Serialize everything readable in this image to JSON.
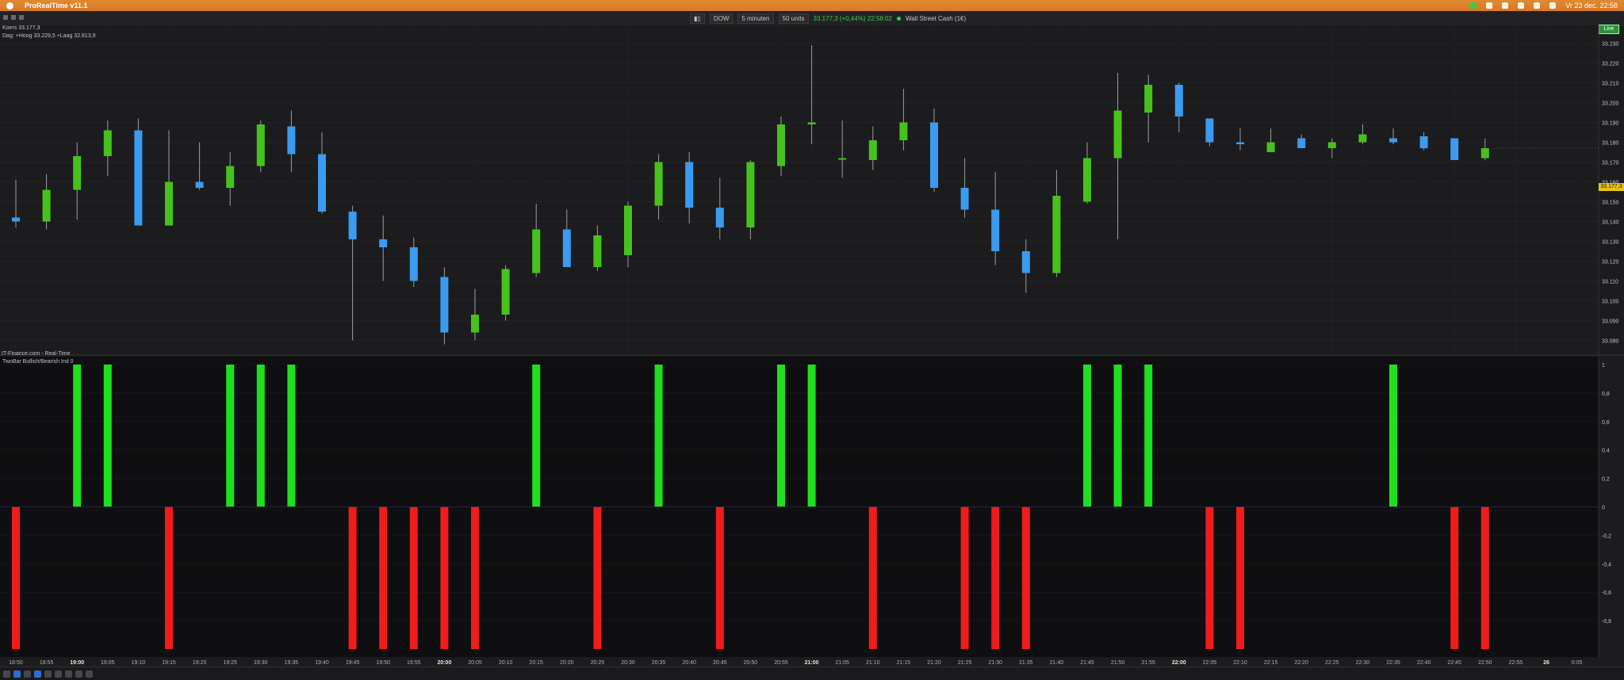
{
  "app": {
    "title": "ProRealTime v11.1",
    "clock": "Vr 23 dec. 22:58"
  },
  "toolbar": {
    "instrument": "DOW",
    "timeframe": "5 minuten",
    "units": "50 units",
    "price_text": "33.177,3 (+0,44%) 22:58:02",
    "market_name": "Wall Street Cash (1€)"
  },
  "chart": {
    "legend_line1": "Koers 33.177,3",
    "legend_line2": "Dag: +Hoog 33.229,5 +Laag 32.813,9",
    "source_label": "IT-Finance.com - Real-Time",
    "indicator_label": "TwoBar Bullish/Bearish Ind 0",
    "mode_badge": "Live",
    "last_price_badge": "33.177,3",
    "price_axis_labels": [
      "33.230",
      "33.220",
      "33.210",
      "33.200",
      "33.190",
      "33.180",
      "33.170",
      "33.160",
      "33.150",
      "33.140",
      "33.130",
      "33.120",
      "33.110",
      "33.100",
      "33.090",
      "33.080"
    ],
    "indicator_axis_labels": [
      "1",
      "0,8",
      "0,6",
      "0,4",
      "0,2",
      "0",
      "-0,2",
      "-0,4",
      "-0,6",
      "-0,8"
    ],
    "time_labels": [
      "18:50",
      "18:55",
      "19:00",
      "19:05",
      "19:10",
      "19:15",
      "19:20",
      "19:25",
      "19:30",
      "19:35",
      "19:40",
      "19:45",
      "19:50",
      "19:55",
      "20:00",
      "20:05",
      "20:10",
      "20:15",
      "20:20",
      "20:25",
      "20:30",
      "20:35",
      "20:40",
      "20:45",
      "20:50",
      "20:55",
      "21:00",
      "21:05",
      "21:10",
      "21:15",
      "21:20",
      "21:25",
      "21:30",
      "21:35",
      "21:40",
      "21:45",
      "21:50",
      "21:55",
      "22:00",
      "22:05",
      "22:10",
      "22:15",
      "22:20",
      "22:25",
      "22:30",
      "22:35",
      "22:40",
      "22:45",
      "22:50",
      "22:55",
      "26",
      "0:05"
    ],
    "bold_time_labels": [
      "19:00",
      "20:00",
      "21:00",
      "22:00",
      "26"
    ],
    "colors": {
      "bull": "#47c21c",
      "bear": "#3a9bf0",
      "ind_bull": "#1ee01e",
      "ind_bear": "#f01c1c",
      "background": "#1c1c1e",
      "grid": "#2a2a2d"
    }
  },
  "chart_data": {
    "type": "candlestick",
    "x": [
      "18:50",
      "18:55",
      "19:00",
      "19:05",
      "19:10",
      "19:15",
      "19:20",
      "19:25",
      "19:30",
      "19:35",
      "19:40",
      "19:45",
      "19:50",
      "19:55",
      "20:00",
      "20:05",
      "20:10",
      "20:15",
      "20:20",
      "20:25",
      "20:30",
      "20:35",
      "20:40",
      "20:45",
      "20:50",
      "20:55",
      "21:00",
      "21:05",
      "21:10",
      "21:15",
      "21:20",
      "21:25",
      "21:30",
      "21:35",
      "21:40",
      "21:45",
      "21:50",
      "21:55",
      "22:00",
      "22:05",
      "22:10",
      "22:15",
      "22:20",
      "22:25",
      "22:30",
      "22:35",
      "22:40",
      "22:45",
      "22:50"
    ],
    "open": [
      33142,
      33140,
      33156,
      33173,
      33186,
      33138,
      33160,
      33157,
      33168,
      33188,
      33174,
      33145,
      33131,
      33127,
      33112,
      33084,
      33093,
      33114,
      33136,
      33117,
      33123,
      33148,
      33170,
      33147,
      33137,
      33168,
      33189,
      33172,
      33171,
      33181,
      33190,
      33157,
      33146,
      33125,
      33114,
      33150,
      33172,
      33195,
      33209,
      33192,
      33180,
      33175,
      33182,
      33177,
      33180,
      33182,
      33183,
      33182,
      33172
    ],
    "high": [
      33161,
      33164,
      33180,
      33191,
      33192,
      33186,
      33180,
      33175,
      33191,
      33196,
      33185,
      33148,
      33143,
      33132,
      33117,
      33106,
      33118,
      33149,
      33146,
      33138,
      33150,
      33174,
      33175,
      33162,
      33171,
      33193,
      33229,
      33191,
      33188,
      33207,
      33197,
      33172,
      33165,
      33131,
      33166,
      33180,
      33215,
      33214,
      33210,
      33192,
      33187,
      33187,
      33184,
      33182,
      33189,
      33187,
      33185,
      33180,
      33182
    ],
    "low": [
      33137,
      33136,
      33141,
      33163,
      33138,
      33139,
      33156,
      33148,
      33165,
      33165,
      33144,
      33080,
      33110,
      33107,
      33078,
      33080,
      33090,
      33112,
      33117,
      33115,
      33117,
      33141,
      33139,
      33131,
      33131,
      33163,
      33179,
      33162,
      33166,
      33176,
      33155,
      33142,
      33118,
      33104,
      33112,
      33149,
      33131,
      33180,
      33185,
      33178,
      33176,
      33176,
      33177,
      33172,
      33179,
      33179,
      33176,
      33172,
      33171
    ],
    "close": [
      33140,
      33156,
      33173,
      33186,
      33138,
      33160,
      33157,
      33168,
      33189,
      33174,
      33145,
      33131,
      33127,
      33110,
      33084,
      33093,
      33116,
      33136,
      33117,
      33133,
      33148,
      33170,
      33147,
      33137,
      33170,
      33189,
      33190,
      33172,
      33181,
      33190,
      33157,
      33146,
      33125,
      33114,
      33153,
      33172,
      33196,
      33209,
      33193,
      33180,
      33179,
      33180,
      33177,
      33180,
      33184,
      33180,
      33177,
      33171,
      33177
    ],
    "ylim": [
      33075,
      33235
    ],
    "indicator": {
      "name": "TwoBar Bullish/Bearish Ind",
      "values": [
        -1,
        0,
        1,
        1,
        0,
        -1,
        0,
        1,
        1,
        1,
        0,
        -1,
        -1,
        -1,
        -1,
        -1,
        0,
        1,
        0,
        -1,
        0,
        1,
        0,
        -1,
        0,
        1,
        1,
        0,
        -1,
        0,
        0,
        -1,
        -1,
        -1,
        0,
        1,
        1,
        1,
        0,
        -1,
        -1,
        0,
        0,
        0,
        0,
        1,
        0,
        -1,
        -1
      ],
      "ylim": [
        -1,
        1
      ]
    }
  }
}
